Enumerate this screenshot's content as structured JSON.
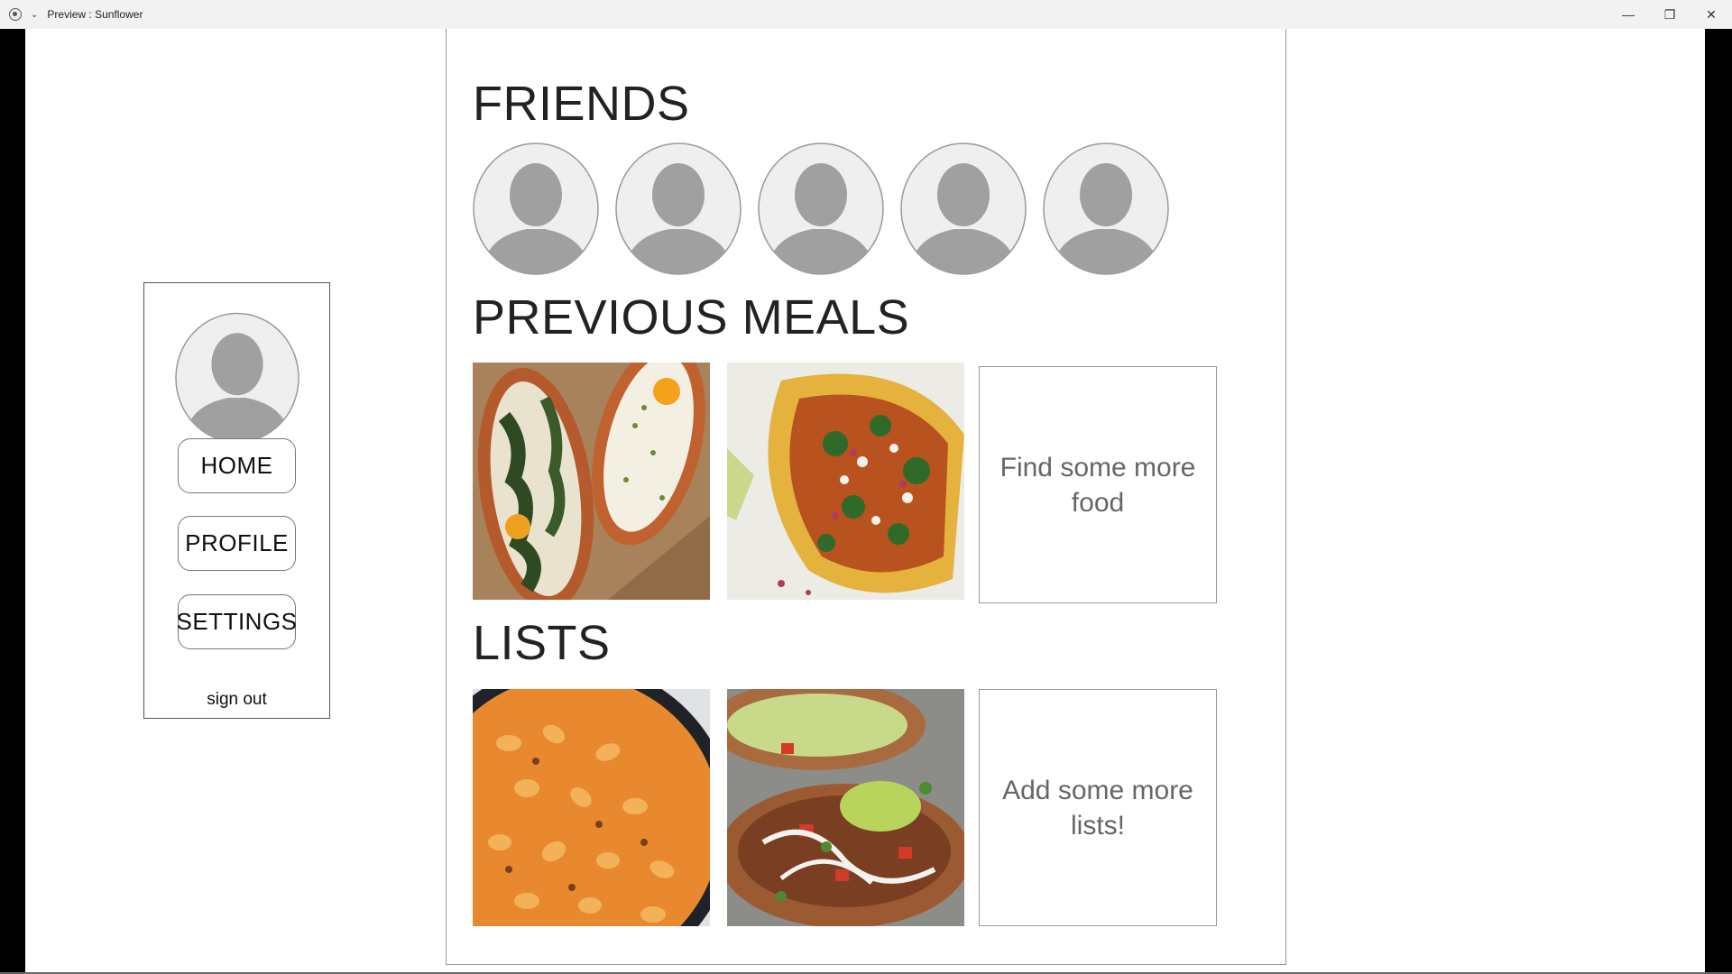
{
  "window": {
    "title": "Preview : Sunflower",
    "controls": {
      "minimize": "—",
      "restore": "❐",
      "close": "✕"
    }
  },
  "sidebar": {
    "avatar_icon": "default-user-avatar",
    "nav": [
      {
        "label": "HOME"
      },
      {
        "label": "PROFILE"
      },
      {
        "label": "SETTINGS"
      }
    ],
    "signout_label": "sign out"
  },
  "sections": {
    "friends": {
      "title": "FRIENDS",
      "avatars": [
        "default-user-avatar",
        "default-user-avatar",
        "default-user-avatar",
        "default-user-avatar",
        "default-user-avatar"
      ]
    },
    "previous_meals": {
      "title": "PREVIOUS MEALS",
      "images": [
        "egg-boats-photo",
        "tacos-photo"
      ],
      "cta_label": "Find some more food"
    },
    "lists": {
      "title": "LISTS",
      "images": [
        "pasta-skillet-photo",
        "stuffed-sweet-potato-photo"
      ],
      "cta_label": "Add some more lists!"
    }
  },
  "colors": {
    "background": "#ffffff",
    "avatar_fill": "#efefef",
    "avatar_silhouette": "#a0a0a0",
    "cta_text": "#666666"
  }
}
